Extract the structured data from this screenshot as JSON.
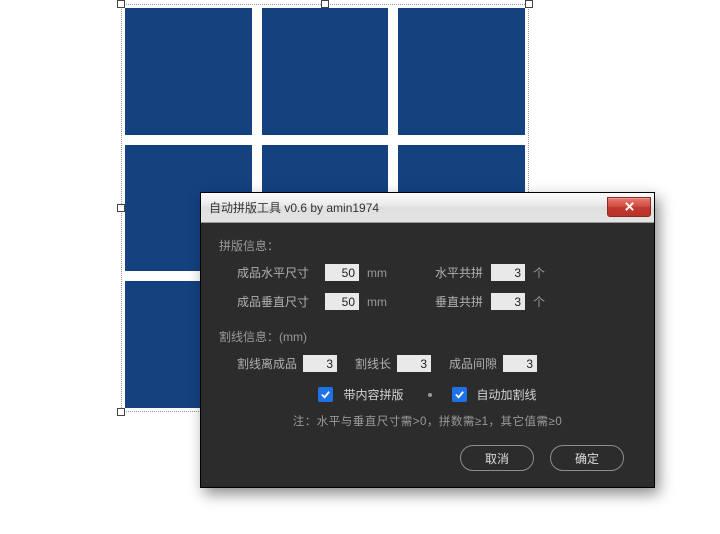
{
  "canvas": {
    "grid": {
      "rows": 3,
      "cols": 3,
      "cell_color": "#13427f"
    }
  },
  "dialog": {
    "title": "自动拼版工具 v0.6   by amin1974",
    "section_layout": {
      "heading": "拼版信息：",
      "size_h_label": "成品水平尺寸",
      "size_h_value": "50",
      "size_h_unit": "mm",
      "count_h_label": "水平共拼",
      "count_h_value": "3",
      "count_h_unit": "个",
      "size_v_label": "成品垂直尺寸",
      "size_v_value": "50",
      "size_v_unit": "mm",
      "count_v_label": "垂直共拼",
      "count_v_value": "3",
      "count_v_unit": "个"
    },
    "section_cut": {
      "heading": "割线信息：(mm)",
      "offset_label": "割线离成品",
      "offset_value": "3",
      "length_label": "割线长",
      "length_value": "3",
      "gap_label": "成品间隙",
      "gap_value": "3"
    },
    "options": {
      "with_content_label": "带内容拼版",
      "with_content_checked": true,
      "auto_cutline_label": "自动加割线",
      "auto_cutline_checked": true
    },
    "note": "注：水平与垂直尺寸需>0，拼数需≥1，其它值需≥0",
    "buttons": {
      "cancel": "取消",
      "ok": "确定"
    }
  }
}
